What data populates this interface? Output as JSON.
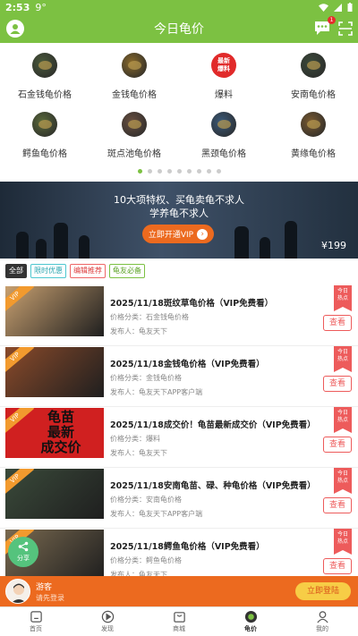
{
  "status": {
    "time": "2:53",
    "network": "9°"
  },
  "header": {
    "title": "今日龟价",
    "msg_badge": "1"
  },
  "categories": [
    {
      "label": "石金钱龟价格",
      "icon": "turtle-photo",
      "color": "#4a5a3a"
    },
    {
      "label": "金钱龟价格",
      "icon": "turtle-photo",
      "color": "#8a6a2a"
    },
    {
      "label": "爆料",
      "icon": "news-badge-icon",
      "color": "#e12a2a",
      "text": "最新\n爆料"
    },
    {
      "label": "安南龟价格",
      "icon": "turtle-photo",
      "color": "#3b4a3a"
    },
    {
      "label": "鳄鱼龟价格",
      "icon": "turtle-photo",
      "color": "#5a6a3a"
    },
    {
      "label": "斑点池龟价格",
      "icon": "turtle-photo",
      "color": "#6a5040"
    },
    {
      "label": "黑颈龟价格",
      "icon": "turtle-photo",
      "color": "#3a5a7a"
    },
    {
      "label": "黄缘龟价格",
      "icon": "turtle-photo",
      "color": "#7a5a30"
    }
  ],
  "carousel": {
    "count": 9,
    "active": 0
  },
  "banner": {
    "line1": "10大项特权、买龟卖龟不求人",
    "line2": "学养龟不求人",
    "cta": "立即开通VIP",
    "price": "¥199"
  },
  "tabs": [
    "全部",
    "限时优惠",
    "编辑推荐",
    "龟友必备"
  ],
  "rows": [
    {
      "title": "2025/11/18斑纹草龟价格（VIP免费看）",
      "category": "价格分类：石金钱龟价格",
      "publisher": "发布人：龟友天下",
      "badge": "VIP",
      "thumb": "#c8a070",
      "today": "今日\n热点",
      "view": "查看"
    },
    {
      "title": "2025/11/18金钱龟价格（VIP免费看）",
      "category": "价格分类：金钱龟价格",
      "publisher": "发布人：龟友天下APP客户端",
      "badge": "VIP",
      "thumb": "#8a4a2a",
      "today": "今日\n热点",
      "view": "查看"
    },
    {
      "title": "2025/11/18成交价！龟苗最新成交价（VIP免费看）",
      "category": "价格分类：爆料",
      "publisher": "发布人：龟友天下",
      "badge": "VIP",
      "thumb": "#d02020",
      "thumb_text": "龟苗\n最新\n成交价",
      "today": "今日\n热点",
      "view": "查看"
    },
    {
      "title": "2025/11/18安南龟苗、碌、种龟价格（VIP免费看）",
      "category": "价格分类：安南龟价格",
      "publisher": "发布人：龟友天下APP客户端",
      "badge": "VIP",
      "thumb": "#3a4a3a",
      "today": "今日\n热点",
      "view": "查看"
    },
    {
      "title": "2025/11/18鳄鱼龟价格（VIP免费看）",
      "category": "价格分类：鳄鱼龟价格",
      "publisher": "发布人：龟友天下",
      "badge": "VIP",
      "thumb": "#7a6a50",
      "today": "今日\n热点",
      "view": "查看"
    }
  ],
  "share": "分享",
  "login": {
    "name": "游客",
    "hint": "请先登录",
    "button": "立即登陆"
  },
  "nav": [
    {
      "label": "首页",
      "icon": "home-icon"
    },
    {
      "label": "发现",
      "icon": "play-icon"
    },
    {
      "label": "商城",
      "icon": "shop-icon"
    },
    {
      "label": "龟价",
      "icon": "price-icon",
      "active": true
    },
    {
      "label": "我的",
      "icon": "user-icon"
    }
  ]
}
